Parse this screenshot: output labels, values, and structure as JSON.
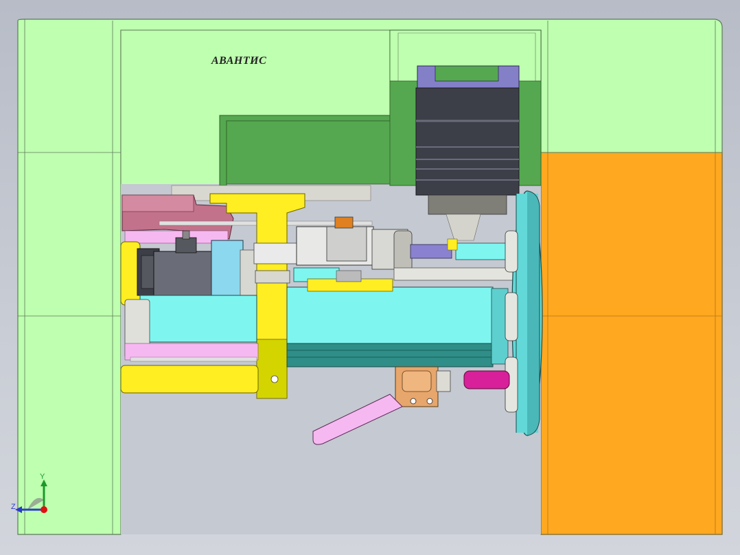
{
  "scene": {
    "brand_label": "АВАНТИС",
    "background_top": "#b7bcc7",
    "background_bottom": "#d2d5dc"
  },
  "parts": {
    "frame_color": "#bfffb0",
    "frame_edge": "#5a7a55",
    "guard_color": "#ffa820",
    "bracket_green": "#55a84f",
    "motor_color": "#3d3f48",
    "spindle_cyan": "#7ff5f0",
    "flange_teal": "#62d8d8",
    "yellow_part": "#ffee22",
    "pink_part": "#f6b8f0",
    "magenta_part": "#d8209a",
    "mauve_part": "#c2728a",
    "orange_part": "#e7a66c",
    "block_blue": "#8cd8ee"
  },
  "triad": {
    "y_label": "Y",
    "z_label": "Z",
    "y_color": "#1a9a2a",
    "z_color": "#2a3cc8",
    "x_color": "#e01010"
  }
}
